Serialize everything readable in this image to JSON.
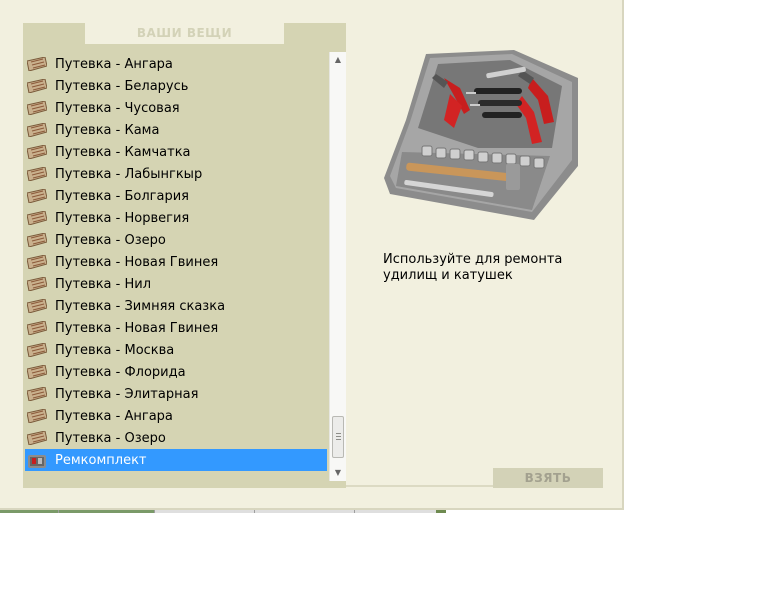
{
  "panel": {
    "title": "ВАШИ ВЕЩИ"
  },
  "items": [
    {
      "label": "Путевка - Ангара",
      "icon": "ticket-icon"
    },
    {
      "label": "Путевка - Беларусь",
      "icon": "ticket-icon"
    },
    {
      "label": "Путевка - Чусовая",
      "icon": "ticket-icon"
    },
    {
      "label": "Путевка - Кама",
      "icon": "ticket-icon"
    },
    {
      "label": "Путевка - Камчатка",
      "icon": "ticket-icon"
    },
    {
      "label": "Путевка - Лабынгкыр",
      "icon": "ticket-icon"
    },
    {
      "label": "Путевка - Болгария",
      "icon": "ticket-icon"
    },
    {
      "label": "Путевка - Норвегия",
      "icon": "ticket-icon"
    },
    {
      "label": "Путевка - Озеро",
      "icon": "ticket-icon"
    },
    {
      "label": "Путевка - Новая Гвинея",
      "icon": "ticket-icon"
    },
    {
      "label": "Путевка - Нил",
      "icon": "ticket-icon"
    },
    {
      "label": "Путевка - Зимняя сказка",
      "icon": "ticket-icon"
    },
    {
      "label": "Путевка - Новая Гвинея",
      "icon": "ticket-icon"
    },
    {
      "label": "Путевка - Москва",
      "icon": "ticket-icon"
    },
    {
      "label": "Путевка - Флорида",
      "icon": "ticket-icon"
    },
    {
      "label": "Путевка - Элитарная",
      "icon": "ticket-icon"
    },
    {
      "label": "Путевка - Ангара",
      "icon": "ticket-icon"
    },
    {
      "label": "Путевка - Озеро",
      "icon": "ticket-icon"
    },
    {
      "label": "Ремкомплект",
      "icon": "repair-kit-icon",
      "selected": true
    }
  ],
  "detail": {
    "description_line1": "Используйте для ремонта",
    "description_line2": "удилищ и катушек",
    "image": "toolbox-image"
  },
  "actions": {
    "take_label": "ВЗЯТЬ"
  },
  "colors": {
    "background": "#f2f0df",
    "panel": "#d5d4b3",
    "selection": "#3399ff",
    "button": "#d3d2b7"
  }
}
